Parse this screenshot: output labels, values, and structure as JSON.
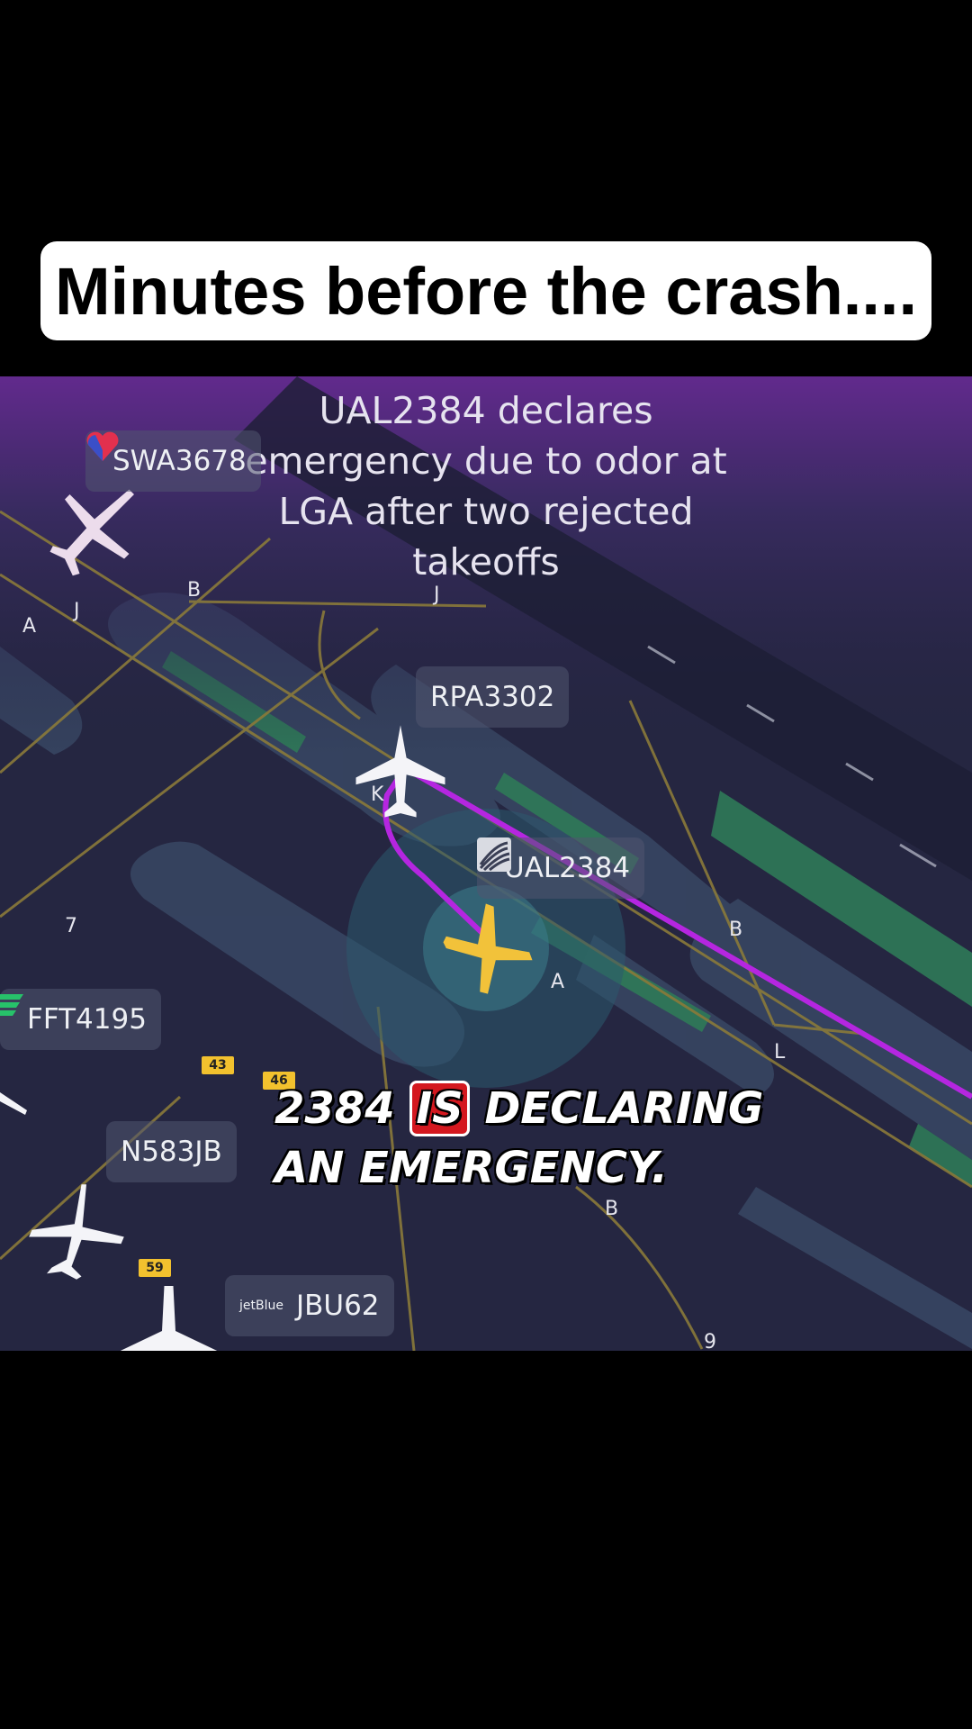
{
  "banner": {
    "title": "Minutes before the crash...."
  },
  "map": {
    "event_text": "UAL2384 declares emergency due to odor at LGA after two rejected takeoffs",
    "colors": {
      "route": "#b526e0",
      "selected_plane": "#f2c23a",
      "plane": "#f4f4f8",
      "runway_green": "#2e7a5a",
      "taxiway": "#8a7a3a"
    },
    "flights": [
      {
        "callsign": "SWA3678",
        "logo": "southwest-heart-icon"
      },
      {
        "callsign": "RPA3302",
        "logo": ""
      },
      {
        "callsign": "UAL2384",
        "logo": "united-globe-icon",
        "selected": true
      },
      {
        "callsign": "FFT4195",
        "logo": "frontier-icon"
      },
      {
        "callsign": "N583JB",
        "logo": ""
      },
      {
        "callsign": "JBU62",
        "logo": "jetBlue"
      }
    ],
    "gates": [
      "43",
      "46",
      "59"
    ],
    "taxiway_labels": [
      "B",
      "J",
      "A",
      "J",
      "K",
      "B",
      "A",
      "L",
      "B",
      "9",
      "7"
    ]
  },
  "caption": {
    "line1_pre": "2384 ",
    "line1_highlight": "IS",
    "line1_post": " DECLARING",
    "line2": "AN EMERGENCY."
  }
}
